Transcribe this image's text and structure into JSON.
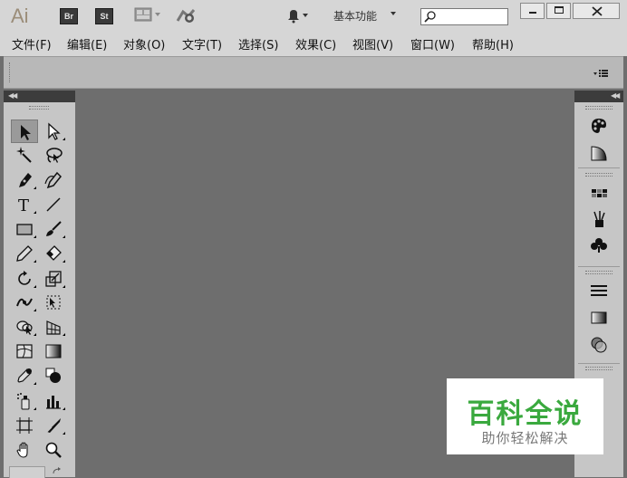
{
  "app": {
    "logo_text": "Ai",
    "bridge_badge": "Br",
    "stock_badge": "St",
    "workspace_label": "基本功能",
    "search": {
      "value": "",
      "placeholder": ""
    }
  },
  "menu": [
    {
      "label": "文件(F)"
    },
    {
      "label": "编辑(E)"
    },
    {
      "label": "对象(O)"
    },
    {
      "label": "文字(T)"
    },
    {
      "label": "选择(S)"
    },
    {
      "label": "效果(C)"
    },
    {
      "label": "视图(V)"
    },
    {
      "label": "窗口(W)"
    },
    {
      "label": "帮助(H)"
    }
  ],
  "toolbox": {
    "tools": [
      {
        "name": "selection-tool-icon",
        "selected": true
      },
      {
        "name": "direct-selection-tool-icon"
      },
      {
        "name": "magic-wand-tool-icon"
      },
      {
        "name": "lasso-tool-icon"
      },
      {
        "name": "pen-tool-icon"
      },
      {
        "name": "curvature-tool-icon"
      },
      {
        "name": "type-tool-icon",
        "glyph": "T"
      },
      {
        "name": "line-segment-tool-icon"
      },
      {
        "name": "rectangle-tool-icon"
      },
      {
        "name": "paintbrush-tool-icon"
      },
      {
        "name": "pencil-tool-icon"
      },
      {
        "name": "eraser-tool-icon"
      },
      {
        "name": "rotate-tool-icon"
      },
      {
        "name": "scale-tool-icon"
      },
      {
        "name": "width-tool-icon"
      },
      {
        "name": "free-transform-tool-icon"
      },
      {
        "name": "shape-builder-tool-icon"
      },
      {
        "name": "perspective-grid-tool-icon"
      },
      {
        "name": "mesh-tool-icon"
      },
      {
        "name": "gradient-tool-icon"
      },
      {
        "name": "eyedropper-tool-icon"
      },
      {
        "name": "blend-tool-icon"
      },
      {
        "name": "symbol-sprayer-tool-icon"
      },
      {
        "name": "column-graph-tool-icon"
      },
      {
        "name": "artboard-tool-icon"
      },
      {
        "name": "slice-tool-icon"
      },
      {
        "name": "hand-tool-icon"
      },
      {
        "name": "zoom-tool-icon"
      }
    ]
  },
  "right_panel": {
    "icons": [
      "color-panel-icon",
      "color-guide-icon",
      "swatches-panel-icon",
      "brushes-panel-icon",
      "symbols-panel-icon",
      "stroke-panel-icon",
      "gradient-panel-icon",
      "transparency-panel-icon"
    ]
  },
  "watermark": {
    "title": "百科全说",
    "subtitle": "助你轻松解决"
  },
  "colors": {
    "canvas": "#6e6e6e",
    "chrome": "#d6d6d6",
    "panel": "#c6c6c6",
    "watermark_green": "#3aa93e"
  }
}
